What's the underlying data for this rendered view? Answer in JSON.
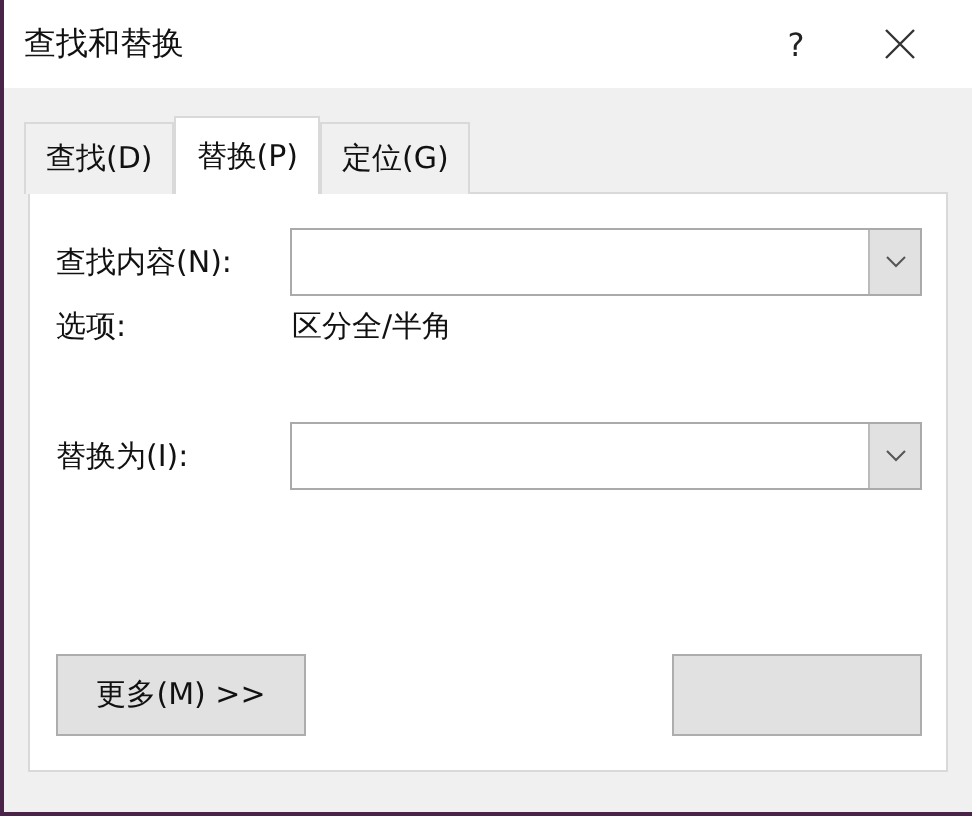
{
  "window": {
    "title": "查找和替换",
    "help": "?"
  },
  "tabs": [
    {
      "label": "查找(D)",
      "selected": false
    },
    {
      "label": "替换(P)",
      "selected": true
    },
    {
      "label": "定位(G)",
      "selected": false
    }
  ],
  "find": {
    "label": "查找内容(N):"
  },
  "options": {
    "label": "选项:",
    "value": "区分全/半角"
  },
  "replace": {
    "label": "替换为(I):"
  },
  "buttons": [
    {
      "kind": "more",
      "label": "更多(M) >>"
    },
    {
      "kind": "blank"
    }
  ]
}
